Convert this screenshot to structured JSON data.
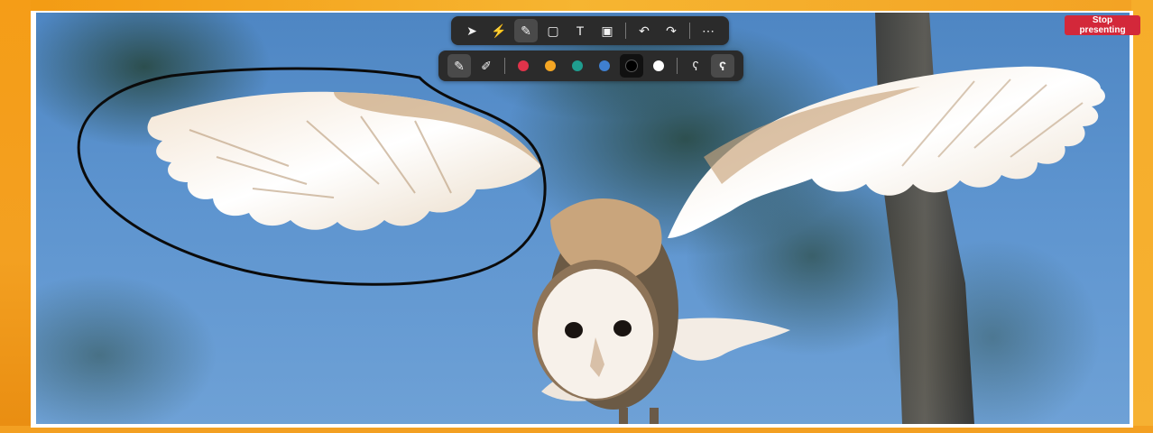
{
  "stop_button": {
    "label": "Stop presenting",
    "color": "#d3283a"
  },
  "toolbar_top": {
    "items": [
      {
        "name": "select-tool",
        "icon": "cursor-arrow-icon",
        "glyph": "➤"
      },
      {
        "name": "laser-tool",
        "icon": "lightning-icon",
        "glyph": "⚡"
      },
      {
        "name": "pen-tool",
        "icon": "pen-icon",
        "glyph": "✎",
        "active": true
      },
      {
        "name": "shape-tool",
        "icon": "square-icon",
        "glyph": "▢"
      },
      {
        "name": "text-tool",
        "icon": "text-icon",
        "glyph": "T"
      },
      {
        "name": "image-tool",
        "icon": "image-icon",
        "glyph": "▣"
      },
      {
        "name": "undo-button",
        "icon": "undo-icon",
        "glyph": "↶"
      },
      {
        "name": "redo-button",
        "icon": "redo-icon",
        "glyph": "↷"
      },
      {
        "name": "more-button",
        "icon": "more-icon",
        "glyph": "⋯"
      }
    ]
  },
  "toolbar_bottom": {
    "tools": [
      {
        "name": "pen-type-pen",
        "icon": "pen-icon",
        "glyph": "✎",
        "active": true
      },
      {
        "name": "pen-type-highlighter",
        "icon": "highlighter-icon",
        "glyph": "✐"
      }
    ],
    "colors": [
      {
        "name": "color-red",
        "hex": "#e0334a"
      },
      {
        "name": "color-orange",
        "hex": "#f5a623"
      },
      {
        "name": "color-teal",
        "hex": "#1f9d8f"
      },
      {
        "name": "color-blue",
        "hex": "#3f7fcf"
      },
      {
        "name": "color-black",
        "hex": "#000000",
        "active": true
      },
      {
        "name": "color-white",
        "hex": "#ffffff"
      }
    ],
    "strokes": [
      {
        "name": "stroke-thin",
        "icon": "squiggle-thin-icon",
        "glyph": "ʕ"
      },
      {
        "name": "stroke-thick",
        "icon": "squiggle-thick-icon",
        "glyph": "ʕ"
      }
    ]
  },
  "frame_color": "#f7a21b",
  "annotation_color": "#000000"
}
